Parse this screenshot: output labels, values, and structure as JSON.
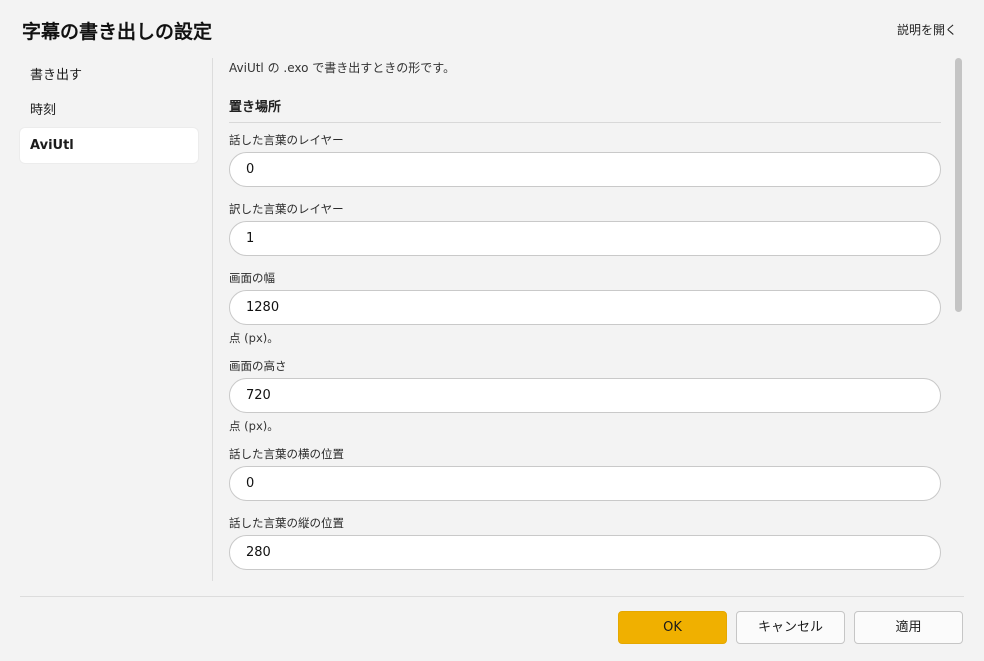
{
  "window": {
    "title": "字幕の書き出しの設定",
    "help_link": "説明を開く"
  },
  "sidebar": {
    "items": [
      {
        "label": "書き出す",
        "selected": false
      },
      {
        "label": "時刻",
        "selected": false
      },
      {
        "label": "AviUtl",
        "selected": true
      }
    ]
  },
  "main": {
    "description": "AviUtl の .exo で書き出すときの形です。",
    "section_title": "置き場所",
    "fields": [
      {
        "label": "話した言葉のレイヤー",
        "value": "0"
      },
      {
        "label": "訳した言葉のレイヤー",
        "value": "1"
      },
      {
        "label": "画面の幅",
        "value": "1280",
        "hint": "点 (px)。"
      },
      {
        "label": "画面の高さ",
        "value": "720",
        "hint": "点 (px)。"
      },
      {
        "label": "話した言葉の横の位置",
        "value": "0"
      },
      {
        "label": "話した言葉の縦の位置",
        "value": "280"
      }
    ]
  },
  "footer": {
    "ok_label": "OK",
    "cancel_label": "キャンセル",
    "apply_label": "適用"
  },
  "colors": {
    "accent": "#f0b000",
    "background": "#f3f3f3"
  }
}
